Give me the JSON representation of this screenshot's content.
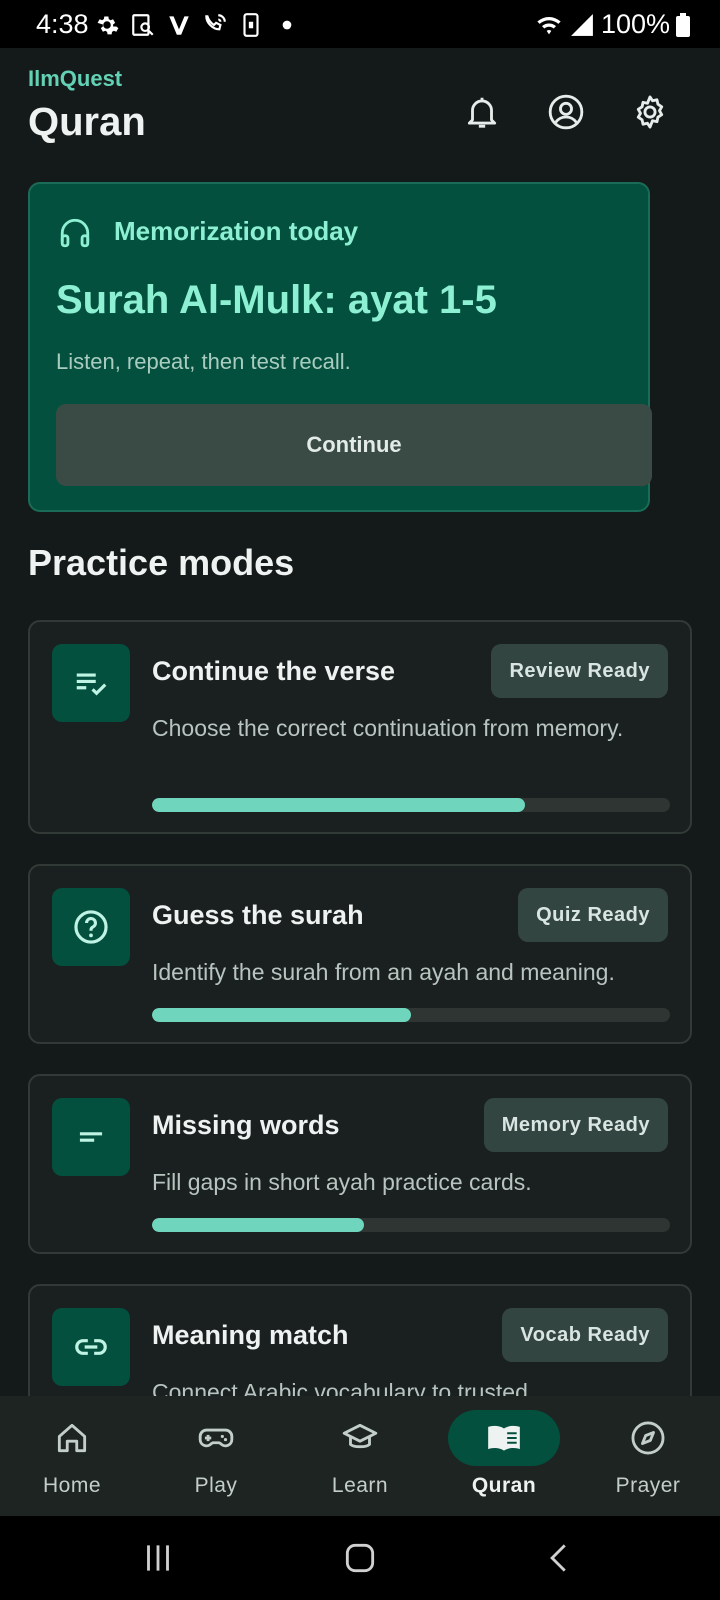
{
  "status_bar": {
    "time": "4:38",
    "battery": "100%"
  },
  "app": {
    "brand": "IlmQuest",
    "title": "Quran"
  },
  "hero": {
    "label": "Memorization today",
    "title": "Surah Al-Mulk: ayat 1-5",
    "subtitle": "Listen, repeat, then test recall.",
    "button": "Continue"
  },
  "section_title": "Practice modes",
  "cards": [
    {
      "title": "Continue the verse",
      "badge": "Review Ready",
      "desc": "Choose the correct continuation from memory.",
      "progress": 0.72,
      "icon": "checklist-icon"
    },
    {
      "title": "Guess the surah",
      "badge": "Quiz Ready",
      "desc": "Identify the surah from an ayah and meaning.",
      "progress": 0.5,
      "icon": "question-icon"
    },
    {
      "title": "Missing words",
      "badge": "Memory Ready",
      "desc": "Fill gaps in short ayah practice cards.",
      "progress": 0.41,
      "icon": "short-text-icon"
    },
    {
      "title": "Meaning match",
      "badge": "Vocab Ready",
      "desc": "Connect Arabic vocabulary to trusted",
      "progress": null,
      "icon": "link-icon"
    }
  ],
  "nav": [
    {
      "label": "Home",
      "icon": "home-icon",
      "active": false
    },
    {
      "label": "Play",
      "icon": "gamepad-icon",
      "active": false
    },
    {
      "label": "Learn",
      "icon": "school-icon",
      "active": false
    },
    {
      "label": "Quran",
      "icon": "book-icon",
      "active": true
    },
    {
      "label": "Prayer",
      "icon": "compass-icon",
      "active": false
    }
  ],
  "colors": {
    "accent": "#63d1b5",
    "hero_bg": "#03503f",
    "background": "#141a19"
  }
}
